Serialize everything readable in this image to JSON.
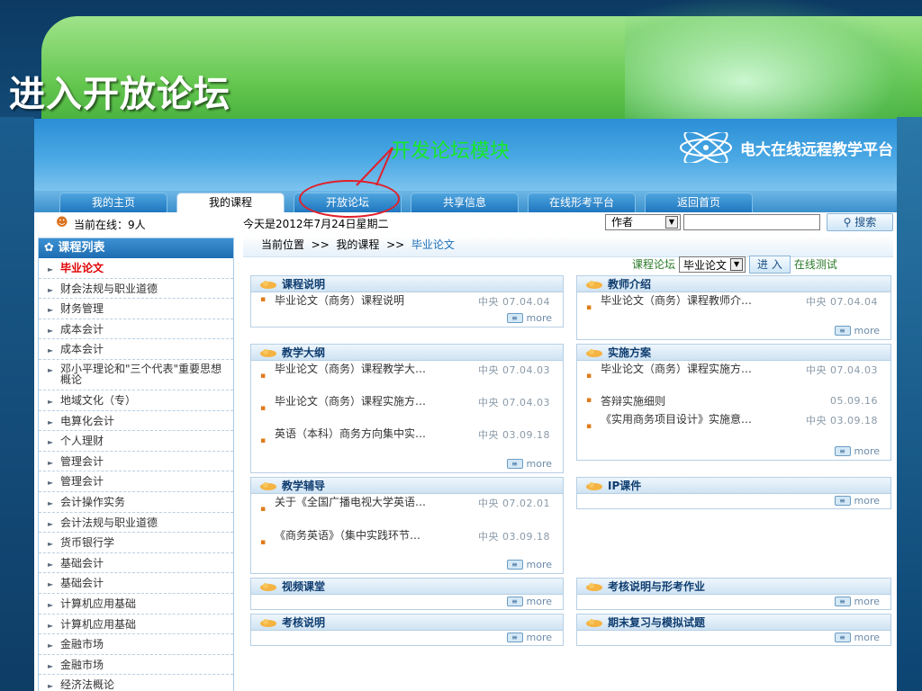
{
  "slide": {
    "title": "进入开放论坛"
  },
  "annotation": {
    "note": "开发论坛模块"
  },
  "site": {
    "brand": "电大在线远程教学平台"
  },
  "tabs": [
    {
      "label": "我的主页"
    },
    {
      "label": "我的课程",
      "active": true
    },
    {
      "label": "开放论坛"
    },
    {
      "label": "共享信息"
    },
    {
      "label": "在线形考平台"
    },
    {
      "label": "返回首页"
    }
  ],
  "infobar": {
    "online": "当前在线：9人",
    "date": "今天是2012年7月24日星期二",
    "search_option": "作者",
    "search_input": "",
    "search_button": "搜索"
  },
  "sidebar": {
    "title": "课程列表",
    "items": [
      "毕业论文",
      "财会法规与职业道德",
      "财务管理",
      "成本会计",
      "成本会计",
      "邓小平理论和\"三个代表\"重要思想概论",
      "地域文化（专）",
      "电算化会计",
      "个人理财",
      "管理会计",
      "管理会计",
      "会计操作实务",
      "会计法规与职业道德",
      "货币银行学",
      "基础会计",
      "基础会计",
      "计算机应用基础",
      "计算机应用基础",
      "金融市场",
      "金融市场",
      "经济法概论"
    ]
  },
  "breadcrumb": {
    "label": "当前位置",
    "sep": ">>",
    "level1": "我的课程",
    "level2": "毕业论文"
  },
  "forumbar": {
    "label": "课程论坛",
    "select": "毕业论文",
    "enter": "进 入",
    "link": "在线测试"
  },
  "more_label": "more",
  "panels": {
    "course_desc": {
      "title": "课程说明",
      "entries": [
        {
          "text": "毕业论文（商务）课程说明",
          "meta": "中央 07.04.04"
        }
      ]
    },
    "teacher": {
      "title": "教师介绍",
      "entries": [
        {
          "text": "毕业论文（商务）课程教师介…",
          "meta": "中央 07.04.04"
        }
      ]
    },
    "syllabus": {
      "title": "教学大纲",
      "entries": [
        {
          "text": "毕业论文（商务）课程教学大…",
          "meta": "中央 07.04.03"
        },
        {
          "text": "毕业论文（商务）课程实施方…",
          "meta": "中央 07.04.03"
        },
        {
          "text": "英语（本科）商务方向集中实…",
          "meta": "中央 03.09.18"
        }
      ]
    },
    "plan": {
      "title": "实施方案",
      "entries": [
        {
          "text": "毕业论文（商务）课程实施方…",
          "meta": "中央 07.04.03"
        },
        {
          "text": "答辩实施细则",
          "meta": "05.09.16"
        },
        {
          "text": "《实用商务项目设计》实施意…",
          "meta": "中央 03.09.18"
        }
      ]
    },
    "tutoring": {
      "title": "教学辅导",
      "entries": [
        {
          "text": "关于《全国广播电视大学英语…",
          "meta": "中央 07.02.01"
        },
        {
          "text": "《商务英语》（集中实践环节…",
          "meta": "中央 03.09.18"
        }
      ]
    },
    "ip": {
      "title": "IP课件"
    },
    "video": {
      "title": "视频课堂"
    },
    "exam_info": {
      "title": "考核说明与形考作业"
    },
    "assessment": {
      "title": "考核说明"
    },
    "review": {
      "title": "期末复习与模拟试题"
    }
  }
}
